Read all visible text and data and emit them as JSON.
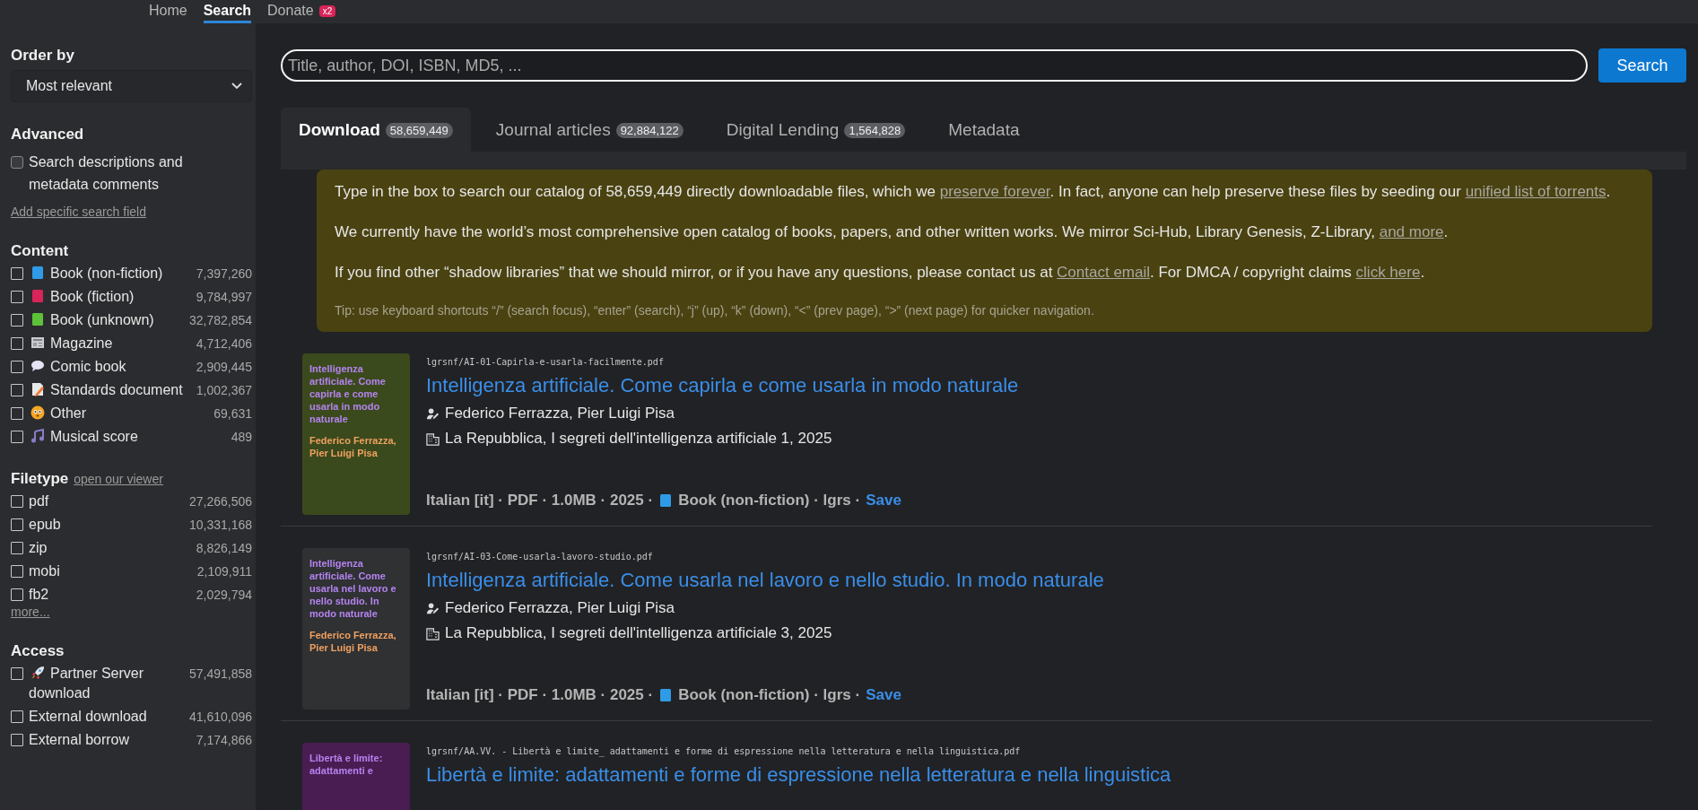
{
  "nav": [
    {
      "label": "Home",
      "selected": false
    },
    {
      "label": "Search",
      "selected": true
    },
    {
      "label": "Donate",
      "selected": false,
      "badge": "x2"
    }
  ],
  "sidebar": {
    "order_by": {
      "heading": "Order by",
      "value": "Most relevant"
    },
    "advanced": {
      "heading": "Advanced",
      "option": {
        "label": "Search descriptions and metadata comments",
        "checked": false
      },
      "link": "Add specific search field"
    },
    "content": {
      "heading": "Content",
      "items": [
        {
          "kind": "book",
          "color": "#2f9be6",
          "label": "Book (non-fiction)",
          "count": "7,397,260",
          "checked": false
        },
        {
          "kind": "book",
          "color": "#d8245a",
          "label": "Book (fiction)",
          "count": "9,784,997",
          "checked": false
        },
        {
          "kind": "book",
          "color": "#5cc23a",
          "label": "Book (unknown)",
          "count": "32,782,854",
          "checked": false
        },
        {
          "kind": "magazine",
          "label": "Magazine",
          "count": "4,712,406",
          "checked": false
        },
        {
          "kind": "comic",
          "label": "Comic book",
          "count": "2,909,445",
          "checked": false
        },
        {
          "kind": "standards",
          "label": "Standards document",
          "count": "1,002,367",
          "checked": false
        },
        {
          "kind": "other",
          "label": "Other",
          "count": "69,631",
          "checked": false
        },
        {
          "kind": "music",
          "label": "Musical score",
          "count": "489",
          "checked": false
        }
      ]
    },
    "filetype": {
      "heading": "Filetype",
      "link": "open our viewer",
      "items": [
        {
          "label": "pdf",
          "count": "27,266,506",
          "checked": false
        },
        {
          "label": "epub",
          "count": "10,331,168",
          "checked": false
        },
        {
          "label": "zip",
          "count": "8,826,149",
          "checked": false
        },
        {
          "label": "mobi",
          "count": "2,109,911",
          "checked": false
        },
        {
          "label": "fb2",
          "count": "2,029,794",
          "checked": false
        }
      ],
      "more": "more..."
    },
    "access": {
      "heading": "Access",
      "items": [
        {
          "kind": "rocket",
          "label": "Partner Server download",
          "count": "57,491,858",
          "checked": false
        },
        {
          "kind": "plain",
          "label": "External download",
          "count": "41,610,096",
          "checked": false
        },
        {
          "kind": "plain",
          "label": "External borrow",
          "count": "7,174,866",
          "checked": false
        }
      ]
    }
  },
  "search": {
    "placeholder": "Title, author, DOI, ISBN, MD5, ...",
    "button": "Search"
  },
  "tabs": [
    {
      "label": "Download",
      "count": "58,659,449",
      "selected": true
    },
    {
      "label": "Journal articles",
      "count": "92,884,122",
      "selected": false
    },
    {
      "label": "Digital Lending",
      "count": "1,564,828",
      "selected": false
    },
    {
      "label": "Metadata",
      "selected": false
    }
  ],
  "banner": {
    "paragraphs": [
      [
        {
          "text": "Type in the box to search our catalog of 58,659,449 directly downloadable files, which we "
        },
        {
          "text": "preserve forever",
          "link": true
        },
        {
          "text": ". In fact, anyone can help preserve these files by seeding our "
        },
        {
          "text": "unified list of torrents",
          "link": true
        },
        {
          "text": "."
        }
      ],
      [
        {
          "text": "We currently have the world’s most comprehensive open catalog of books, papers, and other written works. We mirror Sci-Hub, Library Genesis, Z-Library, "
        },
        {
          "text": "and more",
          "link": true
        },
        {
          "text": "."
        }
      ],
      [
        {
          "text": "If you find other “shadow libraries” that we should mirror, or if you have any questions, please contact us at "
        },
        {
          "text": "Contact email",
          "link": true
        },
        {
          "text": ". For DMCA / copyright claims "
        },
        {
          "text": "click here",
          "link": true
        },
        {
          "text": "."
        }
      ]
    ],
    "tip": "Tip: use keyboard shortcuts “/” (search focus), “enter” (search), “j” (up), “k” (down), “<” (prev page), “>” (next page) for quicker navigation."
  },
  "results": [
    {
      "cover": {
        "color": "#3a4a1c",
        "title": "Intelligenza artificiale. Come capirla e come usarla in modo naturale",
        "author": "Federico Ferrazza, Pier Luigi Pisa"
      },
      "path": "lgrsnf/AI-01-Capirla-e-usarla-facilmente.pdf",
      "title": "Intelligenza artificiale. Come capirla e come usarla in modo naturale",
      "authors": "Federico Ferrazza, Pier Luigi Pisa",
      "publisher": "La Repubblica, I segreti dell'intelligenza artificiale 1, 2025",
      "meta_before": "Italian [it] · PDF · 1.0MB · 2025 ·",
      "meta_after": "Book (non-fiction) · lgrs ·",
      "save": "Save"
    },
    {
      "cover": {
        "color": "#2f3133",
        "title": "Intelligenza artificiale. Come usarla nel lavoro e nello studio. In modo naturale",
        "author": "Federico Ferrazza, Pier Luigi Pisa"
      },
      "path": "lgrsnf/AI-03-Come-usarla-lavoro-studio.pdf",
      "title": "Intelligenza artificiale. Come usarla nel lavoro e nello studio. In modo naturale",
      "authors": "Federico Ferrazza, Pier Luigi Pisa",
      "publisher": "La Repubblica, I segreti dell'intelligenza artificiale 3, 2025",
      "meta_before": "Italian [it] · PDF · 1.0MB · 2025 ·",
      "meta_after": "Book (non-fiction) · lgrs ·",
      "save": "Save"
    },
    {
      "cover": {
        "color": "#4a1d52",
        "title": "Libertà e limite: adattamenti e"
      },
      "path": "lgrsnf/AA.VV. - Libertà e limite_ adattamenti e forme di espressione nella letteratura e nella linguistica.pdf",
      "title": "Libertà e limite: adattamenti e forme di espressione nella letteratura e nella linguistica"
    }
  ]
}
